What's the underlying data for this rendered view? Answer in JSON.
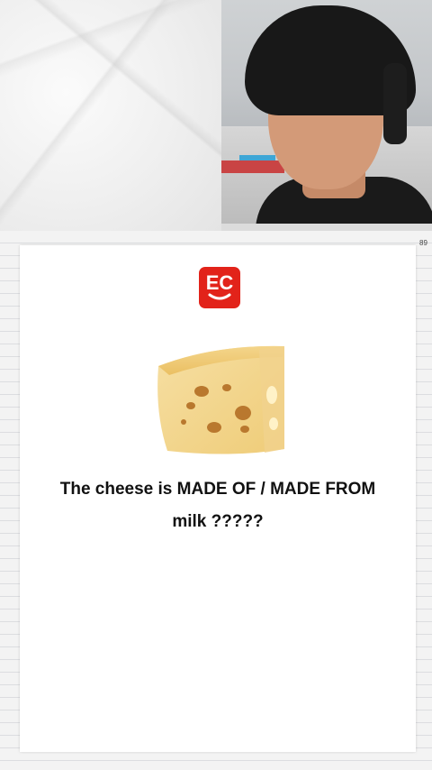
{
  "page": {
    "number": "89"
  },
  "logo": {
    "text": "EC",
    "colors": {
      "brand": "#e2231a"
    }
  },
  "content": {
    "question_line_1": "The cheese is MADE OF / MADE FROM",
    "question_line_2": "milk ?????"
  },
  "icons": [
    "ec-logo-icon",
    "cheese-image"
  ]
}
